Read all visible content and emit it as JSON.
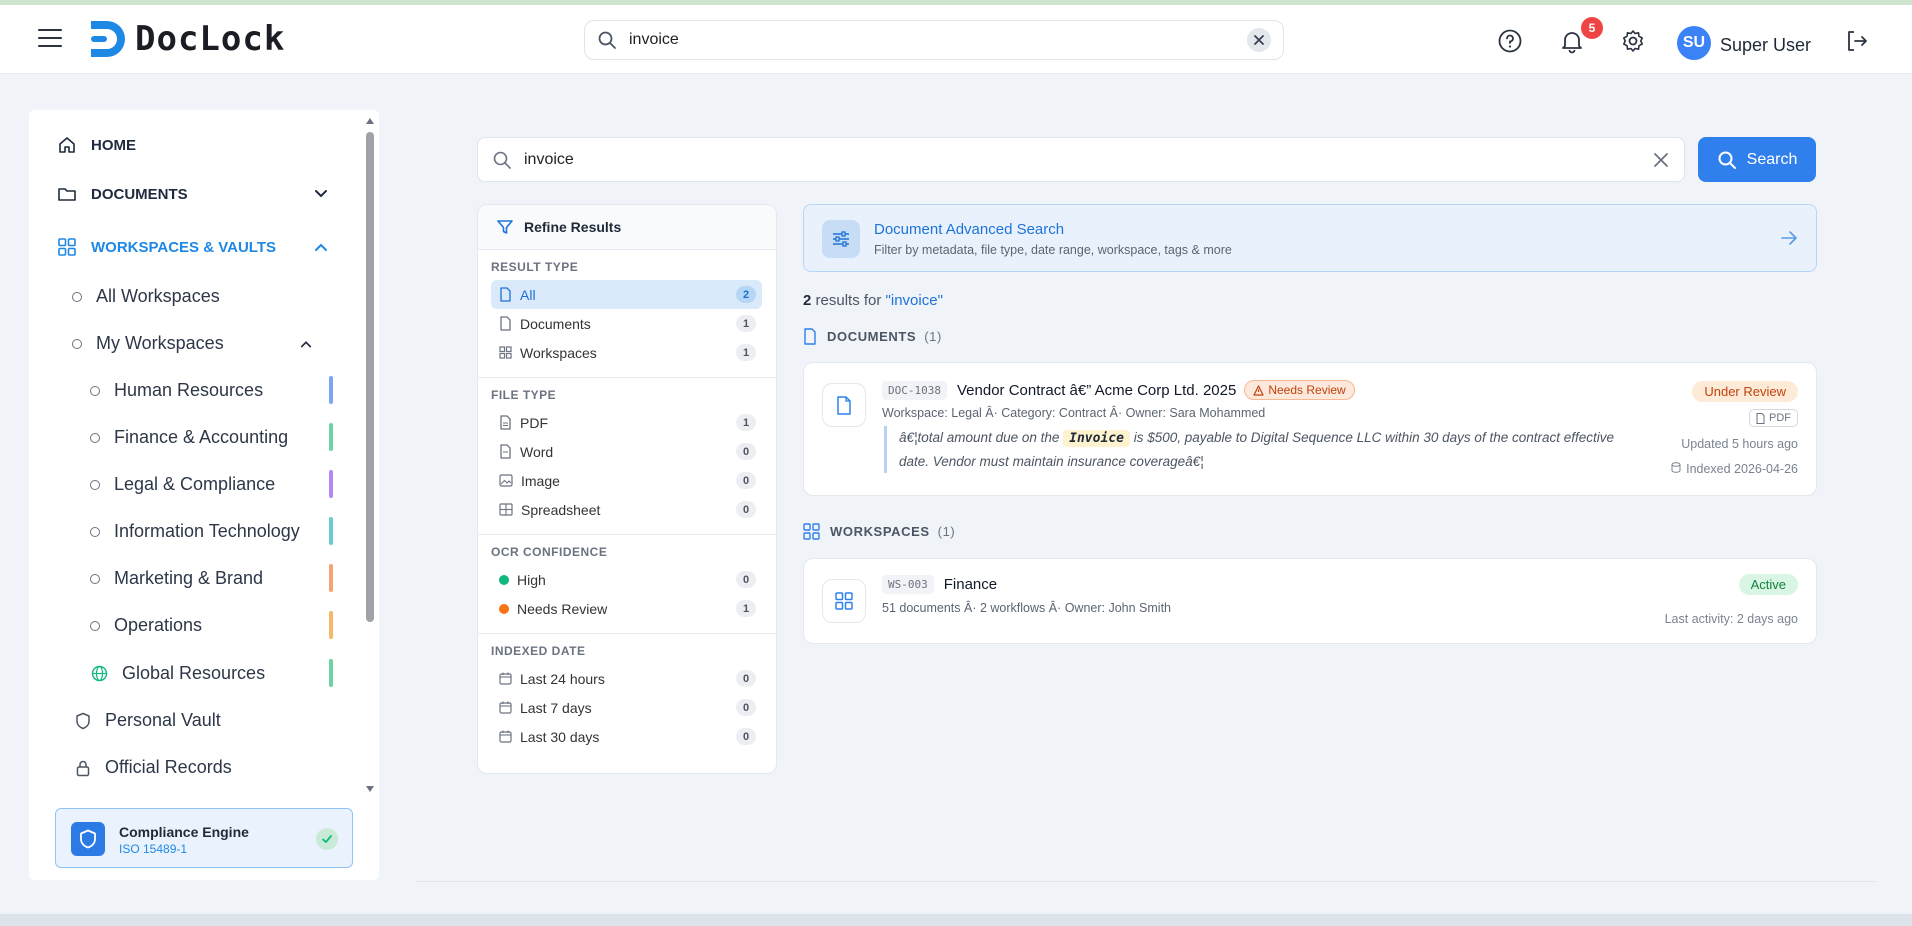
{
  "app": {
    "logo_text": "DocLock"
  },
  "header": {
    "search_value": "invoice",
    "notifications_count": "5",
    "user_initials": "SU",
    "user_name": "Super User"
  },
  "sidebar": {
    "home": "HOME",
    "documents": "DOCUMENTS",
    "workspaces_vaults": "WORKSPACES & VAULTS",
    "all_workspaces": "All Workspaces",
    "my_workspaces": "My Workspaces",
    "workspaces": [
      {
        "label": "Human Resources",
        "color": "#7ea6f0"
      },
      {
        "label": "Finance & Accounting",
        "color": "#6fd3a1"
      },
      {
        "label": "Legal & Compliance",
        "color": "#b388f5"
      },
      {
        "label": "Information Technology",
        "color": "#6cc9d3"
      },
      {
        "label": "Marketing & Brand",
        "color": "#f5a470"
      },
      {
        "label": "Operations",
        "color": "#f3b868"
      },
      {
        "label": "Global Resources",
        "color": "#6fd3a1"
      }
    ],
    "personal_vault": "Personal Vault",
    "official_records": "Official Records",
    "compliance": {
      "title": "Compliance Engine",
      "subtitle": "ISO 15489-1"
    }
  },
  "search": {
    "value": "invoice",
    "button": "Search"
  },
  "filters": {
    "title": "Refine Results",
    "result_type": {
      "title": "RESULT TYPE",
      "items": [
        {
          "label": "All",
          "count": "2"
        },
        {
          "label": "Documents",
          "count": "1"
        },
        {
          "label": "Workspaces",
          "count": "1"
        }
      ]
    },
    "file_type": {
      "title": "FILE TYPE",
      "items": [
        {
          "label": "PDF",
          "count": "1"
        },
        {
          "label": "Word",
          "count": "0"
        },
        {
          "label": "Image",
          "count": "0"
        },
        {
          "label": "Spreadsheet",
          "count": "0"
        }
      ]
    },
    "ocr": {
      "title": "OCR CONFIDENCE",
      "items": [
        {
          "label": "High",
          "count": "0",
          "color": "#10b981"
        },
        {
          "label": "Needs Review",
          "count": "1",
          "color": "#f97316"
        }
      ]
    },
    "indexed": {
      "title": "INDEXED DATE",
      "items": [
        {
          "label": "Last 24 hours",
          "count": "0"
        },
        {
          "label": "Last 7 days",
          "count": "0"
        },
        {
          "label": "Last 30 days",
          "count": "0"
        }
      ]
    }
  },
  "advanced": {
    "title": "Document Advanced Search",
    "subtitle": "Filter by metadata, file type, date range, workspace, tags & more"
  },
  "results": {
    "count": "2",
    "label": "results for",
    "query": "\"invoice\"",
    "documents_heading": "DOCUMENTS",
    "documents_count": "(1)",
    "workspaces_heading": "WORKSPACES",
    "workspaces_count": "(1)",
    "doc": {
      "code": "DOC-1038",
      "title": "Vendor Contract â€” Acme Corp Ltd. 2025",
      "flag": "Needs Review",
      "meta": "Workspace: Legal Â· Category: Contract Â· Owner: Sara Mohammed",
      "snippet_pre": "â€¦total amount due on the",
      "snippet_hl": "Invoice",
      "snippet_mid": "is $500, payable to Digital Sequence LLC within 30 days of the contract effective",
      "snippet_post": "date. Vendor must maintain insurance coverageâ€¦",
      "status": "Under Review",
      "file_type": "PDF",
      "updated": "Updated 5 hours ago",
      "indexed": "Indexed 2026-04-26"
    },
    "ws": {
      "code": "WS-003",
      "title": "Finance",
      "meta": "51 documents Â· 2 workflows Â· Owner: John Smith",
      "status": "Active",
      "last_activity": "Last activity: 2 days ago"
    }
  }
}
